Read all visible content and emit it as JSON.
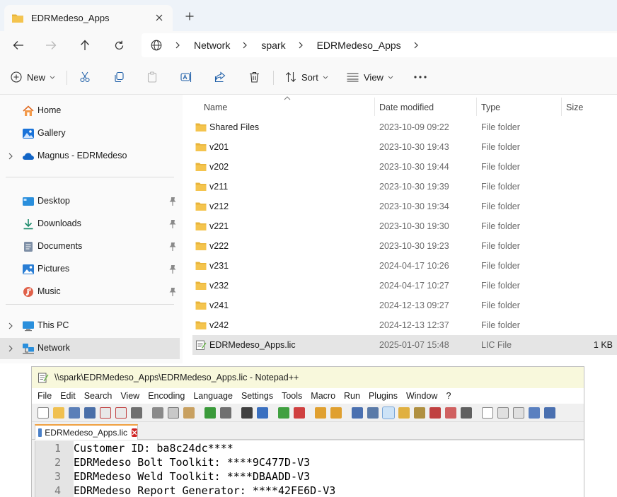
{
  "explorer": {
    "tab": {
      "title": "EDRMedeso_Apps"
    },
    "address": {
      "crumbs": [
        "Network",
        "spark",
        "EDRMedeso_Apps"
      ]
    },
    "commands": {
      "new": "New",
      "sort": "Sort",
      "view": "View"
    },
    "sidebar": {
      "quick": [
        {
          "label": "Home",
          "icon": "home-icon"
        },
        {
          "label": "Gallery",
          "icon": "gallery-icon"
        },
        {
          "label": "Magnus - EDRMedeso",
          "icon": "onedrive-cloud-icon"
        }
      ],
      "pinned": [
        {
          "label": "Desktop",
          "icon": "desktop-icon"
        },
        {
          "label": "Downloads",
          "icon": "downloads-icon"
        },
        {
          "label": "Documents",
          "icon": "documents-icon"
        },
        {
          "label": "Pictures",
          "icon": "pictures-icon"
        },
        {
          "label": "Music",
          "icon": "music-icon"
        }
      ],
      "locations": [
        {
          "label": "This PC",
          "icon": "this-pc-icon"
        },
        {
          "label": "Network",
          "icon": "network-icon"
        }
      ]
    },
    "columns": {
      "name": "Name",
      "date": "Date modified",
      "type": "Type",
      "size": "Size"
    },
    "files": [
      {
        "name": "Shared Files",
        "date": "2023-10-09 09:22",
        "type": "File folder",
        "size": ""
      },
      {
        "name": "v201",
        "date": "2023-10-30 19:43",
        "type": "File folder",
        "size": ""
      },
      {
        "name": "v202",
        "date": "2023-10-30 19:44",
        "type": "File folder",
        "size": ""
      },
      {
        "name": "v211",
        "date": "2023-10-30 19:39",
        "type": "File folder",
        "size": ""
      },
      {
        "name": "v212",
        "date": "2023-10-30 19:34",
        "type": "File folder",
        "size": ""
      },
      {
        "name": "v221",
        "date": "2023-10-30 19:30",
        "type": "File folder",
        "size": ""
      },
      {
        "name": "v222",
        "date": "2023-10-30 19:23",
        "type": "File folder",
        "size": ""
      },
      {
        "name": "v231",
        "date": "2024-04-17 10:26",
        "type": "File folder",
        "size": ""
      },
      {
        "name": "v232",
        "date": "2024-04-17 10:27",
        "type": "File folder",
        "size": ""
      },
      {
        "name": "v241",
        "date": "2024-12-13 09:27",
        "type": "File folder",
        "size": ""
      },
      {
        "name": "v242",
        "date": "2024-12-13 12:37",
        "type": "File folder",
        "size": ""
      },
      {
        "name": "EDRMedeso_Apps.lic",
        "date": "2025-01-07 15:48",
        "type": "LIC File",
        "size": "1 KB"
      }
    ]
  },
  "notepad": {
    "title": "\\\\spark\\EDRMedeso_Apps\\EDRMedeso_Apps.lic - Notepad++",
    "menu": [
      "File",
      "Edit",
      "Search",
      "View",
      "Encoding",
      "Language",
      "Settings",
      "Tools",
      "Macro",
      "Run",
      "Plugins",
      "Window",
      "?"
    ],
    "tab": "EDRMedeso_Apps.lic",
    "lines": [
      {
        "num": "1",
        "text": "Customer ID: ba8c24dc****"
      },
      {
        "num": "2",
        "text": "EDRMedeso Bolt Toolkit: ****9C477D-V3"
      },
      {
        "num": "3",
        "text": "EDRMedeso Weld Toolkit: ****DBAADD-V3"
      },
      {
        "num": "4",
        "text": "EDRMedeso Report Generator: ****42FE6D-V3"
      }
    ]
  },
  "colors": {
    "folder": "#f4c44e",
    "accent_blue": "#0a62c6",
    "notepad_title": "#f8f8dc",
    "selection": "#e5e5e5"
  }
}
